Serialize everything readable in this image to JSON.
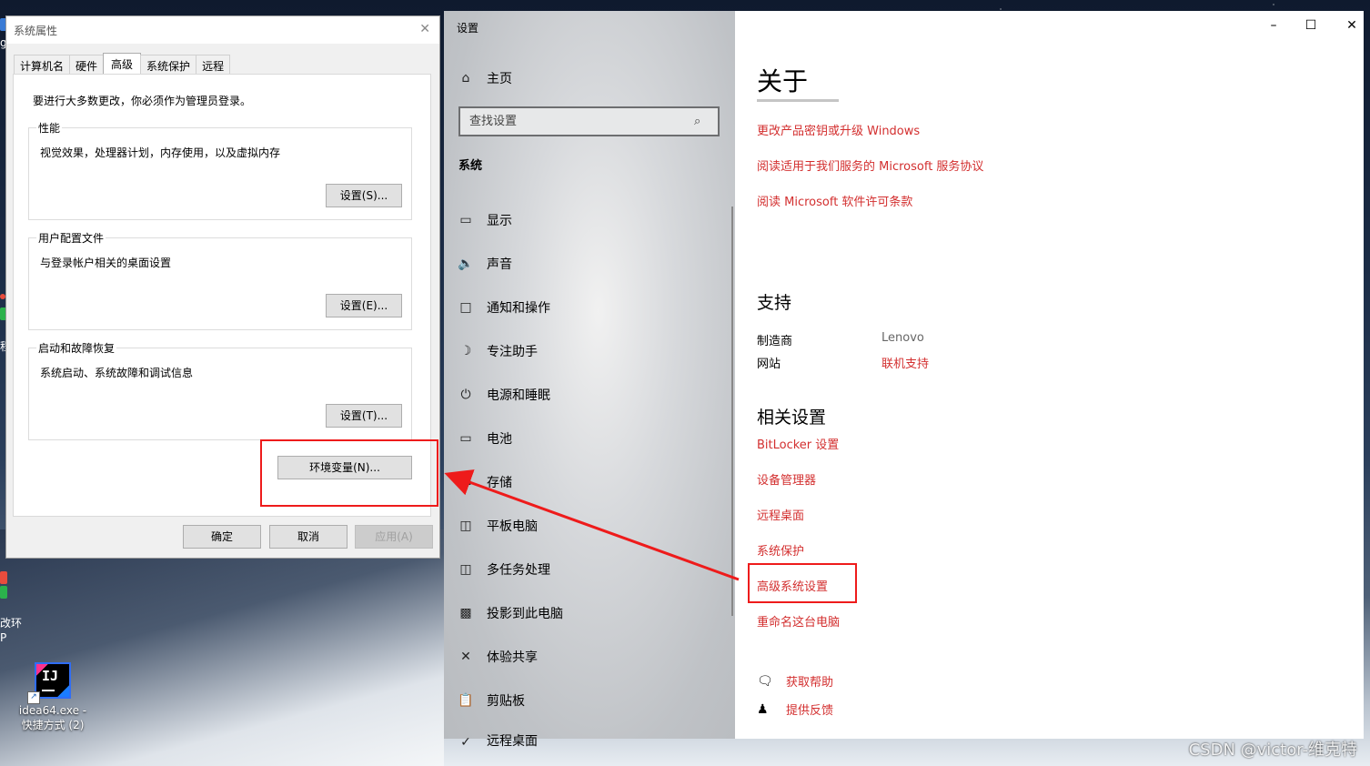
{
  "desktop": {
    "left_edge_text": [
      "g",
      "程",
      "改环",
      "P"
    ],
    "shortcut": {
      "label_line1": "idea64.exe -",
      "label_line2": "快捷方式 (2)",
      "logo_text": "IJ"
    },
    "watermark": "CSDN @victor-维克特"
  },
  "system_properties": {
    "title": "系统属性",
    "tabs": [
      "计算机名",
      "硬件",
      "高级",
      "系统保护",
      "远程"
    ],
    "active_tab": "高级",
    "note": "要进行大多数更改，你必须作为管理员登录。",
    "groups": [
      {
        "title": "性能",
        "desc": "视觉效果，处理器计划，内存使用，以及虚拟内存",
        "button": "设置(S)..."
      },
      {
        "title": "用户配置文件",
        "desc": "与登录帐户相关的桌面设置",
        "button": "设置(E)..."
      },
      {
        "title": "启动和故障恢复",
        "desc": "系统启动、系统故障和调试信息",
        "button": "设置(T)..."
      }
    ],
    "env_button": "环境变量(N)...",
    "ok": "确定",
    "cancel": "取消",
    "apply": "应用(A)"
  },
  "settings": {
    "window_title": "设置",
    "home": "主页",
    "search_placeholder": "查找设置",
    "section": "系统",
    "nav": [
      {
        "label": "显示",
        "icon": "monitor-icon"
      },
      {
        "label": "声音",
        "icon": "speaker-icon"
      },
      {
        "label": "通知和操作",
        "icon": "notification-icon"
      },
      {
        "label": "专注助手",
        "icon": "moon-icon"
      },
      {
        "label": "电源和睡眠",
        "icon": "power-icon"
      },
      {
        "label": "电池",
        "icon": "battery-icon"
      },
      {
        "label": "存储",
        "icon": "storage-icon"
      },
      {
        "label": "平板电脑",
        "icon": "tablet-icon"
      },
      {
        "label": "多任务处理",
        "icon": "multitask-icon"
      },
      {
        "label": "投影到此电脑",
        "icon": "project-icon"
      },
      {
        "label": "体验共享",
        "icon": "share-icon"
      },
      {
        "label": "剪贴板",
        "icon": "clipboard-icon"
      },
      {
        "label": "远程桌面",
        "icon": "remote-icon"
      }
    ],
    "about": {
      "title": "关于",
      "links": [
        "更改产品密钥或升级 Windows",
        "阅读适用于我们服务的 Microsoft 服务协议",
        "阅读 Microsoft 软件许可条款"
      ],
      "support_title": "支持",
      "manufacturer_key": "制造商",
      "manufacturer_val": "Lenovo",
      "website_key": "网站",
      "website_val": "联机支持",
      "related_title": "相关设置",
      "related_links": [
        "BitLocker 设置",
        "设备管理器",
        "远程桌面",
        "系统保护",
        "高级系统设置",
        "重命名这台电脑"
      ],
      "help": "获取帮助",
      "feedback": "提供反馈"
    }
  },
  "colors": {
    "link": "#d32f2f",
    "highlight": "#ee1b1b"
  }
}
